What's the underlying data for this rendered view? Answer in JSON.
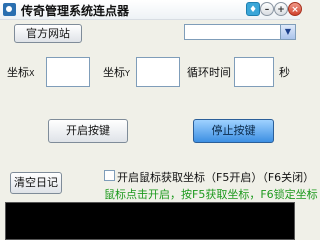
{
  "window": {
    "title": "传奇管理系统连点器",
    "skin_glyph": "♦",
    "minimize_glyph": "–",
    "maximize_glyph": "+",
    "close_glyph": "×"
  },
  "toolbar": {
    "site_button": "官方网站",
    "dropdown_value": "",
    "dropdown_arrow": "▼"
  },
  "coords": {
    "x_prefix": "坐标",
    "x_suffix": "X",
    "x_value": "",
    "y_prefix": "坐标",
    "y_suffix": "Y",
    "y_value": "",
    "loop_label": "循环时间",
    "loop_value": "",
    "seconds_unit": "秒"
  },
  "actions": {
    "start_label": "开启按键",
    "stop_label": "停止按键",
    "clear_log_label": "清空日记"
  },
  "capture": {
    "checkbox_label": "开启鼠标获取坐标（F5开启）（F6关闭）",
    "checked": false,
    "hint": "鼠标点击开启，按F5获取坐标，F6锁定坐标"
  },
  "log": {
    "content": ""
  },
  "colors": {
    "background": "#f0f0e8",
    "hint_text": "#1e9a1e",
    "stop_button": "#3d8fe3",
    "log_background": "#000000"
  },
  "icons": {
    "app": "app-icon",
    "skin": "skin-icon",
    "minimize": "minimize-icon",
    "maximize": "maximize-icon",
    "close": "close-icon",
    "dropdown": "chevron-down-icon"
  }
}
